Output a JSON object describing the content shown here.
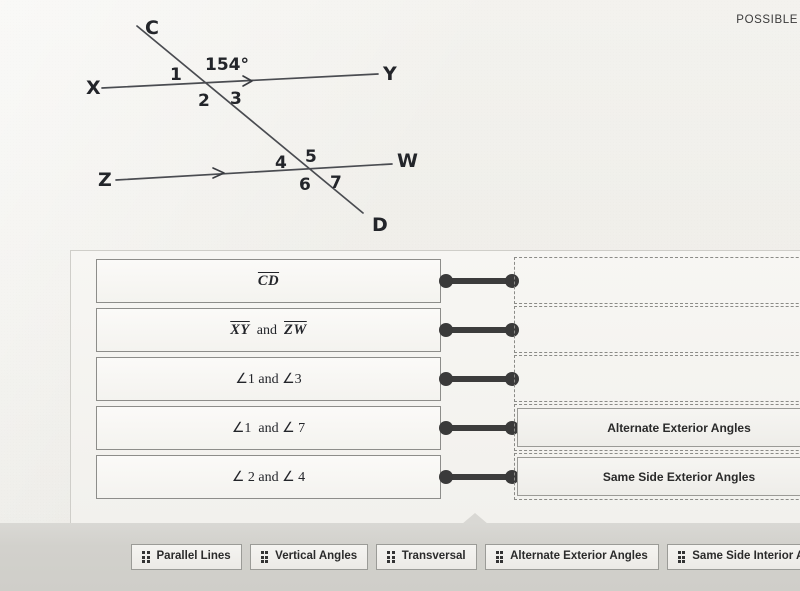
{
  "header": {
    "possible_label": "POSSIBLE"
  },
  "diagram": {
    "type": "two-parallel-lines-cut-by-transversal",
    "given_angle": "154°",
    "points": {
      "C": "C",
      "D": "D",
      "X": "X",
      "Y": "Y",
      "Z": "Z",
      "W": "W"
    },
    "angle_numbers": {
      "n1": "1",
      "n2": "2",
      "n3": "3",
      "n4": "4",
      "n5": "5",
      "n6": "6",
      "n7": "7"
    },
    "lines": [
      {
        "name": "XY",
        "from": "X",
        "to": "Y",
        "arrow": true,
        "role": "parallel-line-top"
      },
      {
        "name": "ZW",
        "from": "Z",
        "to": "W",
        "arrow": true,
        "role": "parallel-line-bottom"
      },
      {
        "name": "CD",
        "from": "C",
        "to": "D",
        "arrow": false,
        "role": "transversal"
      }
    ]
  },
  "matching": {
    "rows": [
      {
        "prompt_html": "<span class='ovl'>CD</span>",
        "prompt_plain": "CD",
        "answer": "",
        "filled": false
      },
      {
        "prompt_html": "<span class='ovl'>XY</span><span class='mathsp'>&nbsp; and &nbsp;</span><span class='ovl'>ZW</span>",
        "prompt_plain": "XY and ZW",
        "answer": "",
        "filled": false
      },
      {
        "prompt_html": "<span class='mathsp'>&#8736;1 and &#8736;3</span>",
        "prompt_plain": "∠1 and ∠3",
        "answer": "",
        "filled": false
      },
      {
        "prompt_html": "<span class='mathsp'>&#8736;1 &nbsp;and &#8736; 7</span>",
        "prompt_plain": "∠1 and ∠7",
        "answer": "Alternate Exterior Angles",
        "filled": true
      },
      {
        "prompt_html": "<span class='mathsp'>&#8736; 2 and &#8736; 4</span>",
        "prompt_plain": "∠2 and ∠4",
        "answer": "Same Side Exterior Angles",
        "filled": true
      }
    ]
  },
  "answer_bank": {
    "chips": [
      {
        "label": "Parallel Lines"
      },
      {
        "label": "Vertical Angles"
      },
      {
        "label": "Transversal"
      },
      {
        "label": "Alternate Exterior Angles"
      },
      {
        "label": "Same Side Interior Angles"
      }
    ]
  },
  "colors": {
    "page_bg": "#f1f0ec",
    "panel_bg": "#f5f4f1",
    "tray_bg": "#d5d4cf",
    "ink": "#23252a",
    "connector": "#3a3a3a",
    "box_border": "#8d8d8a",
    "dashed_border": "#8b8b87"
  }
}
